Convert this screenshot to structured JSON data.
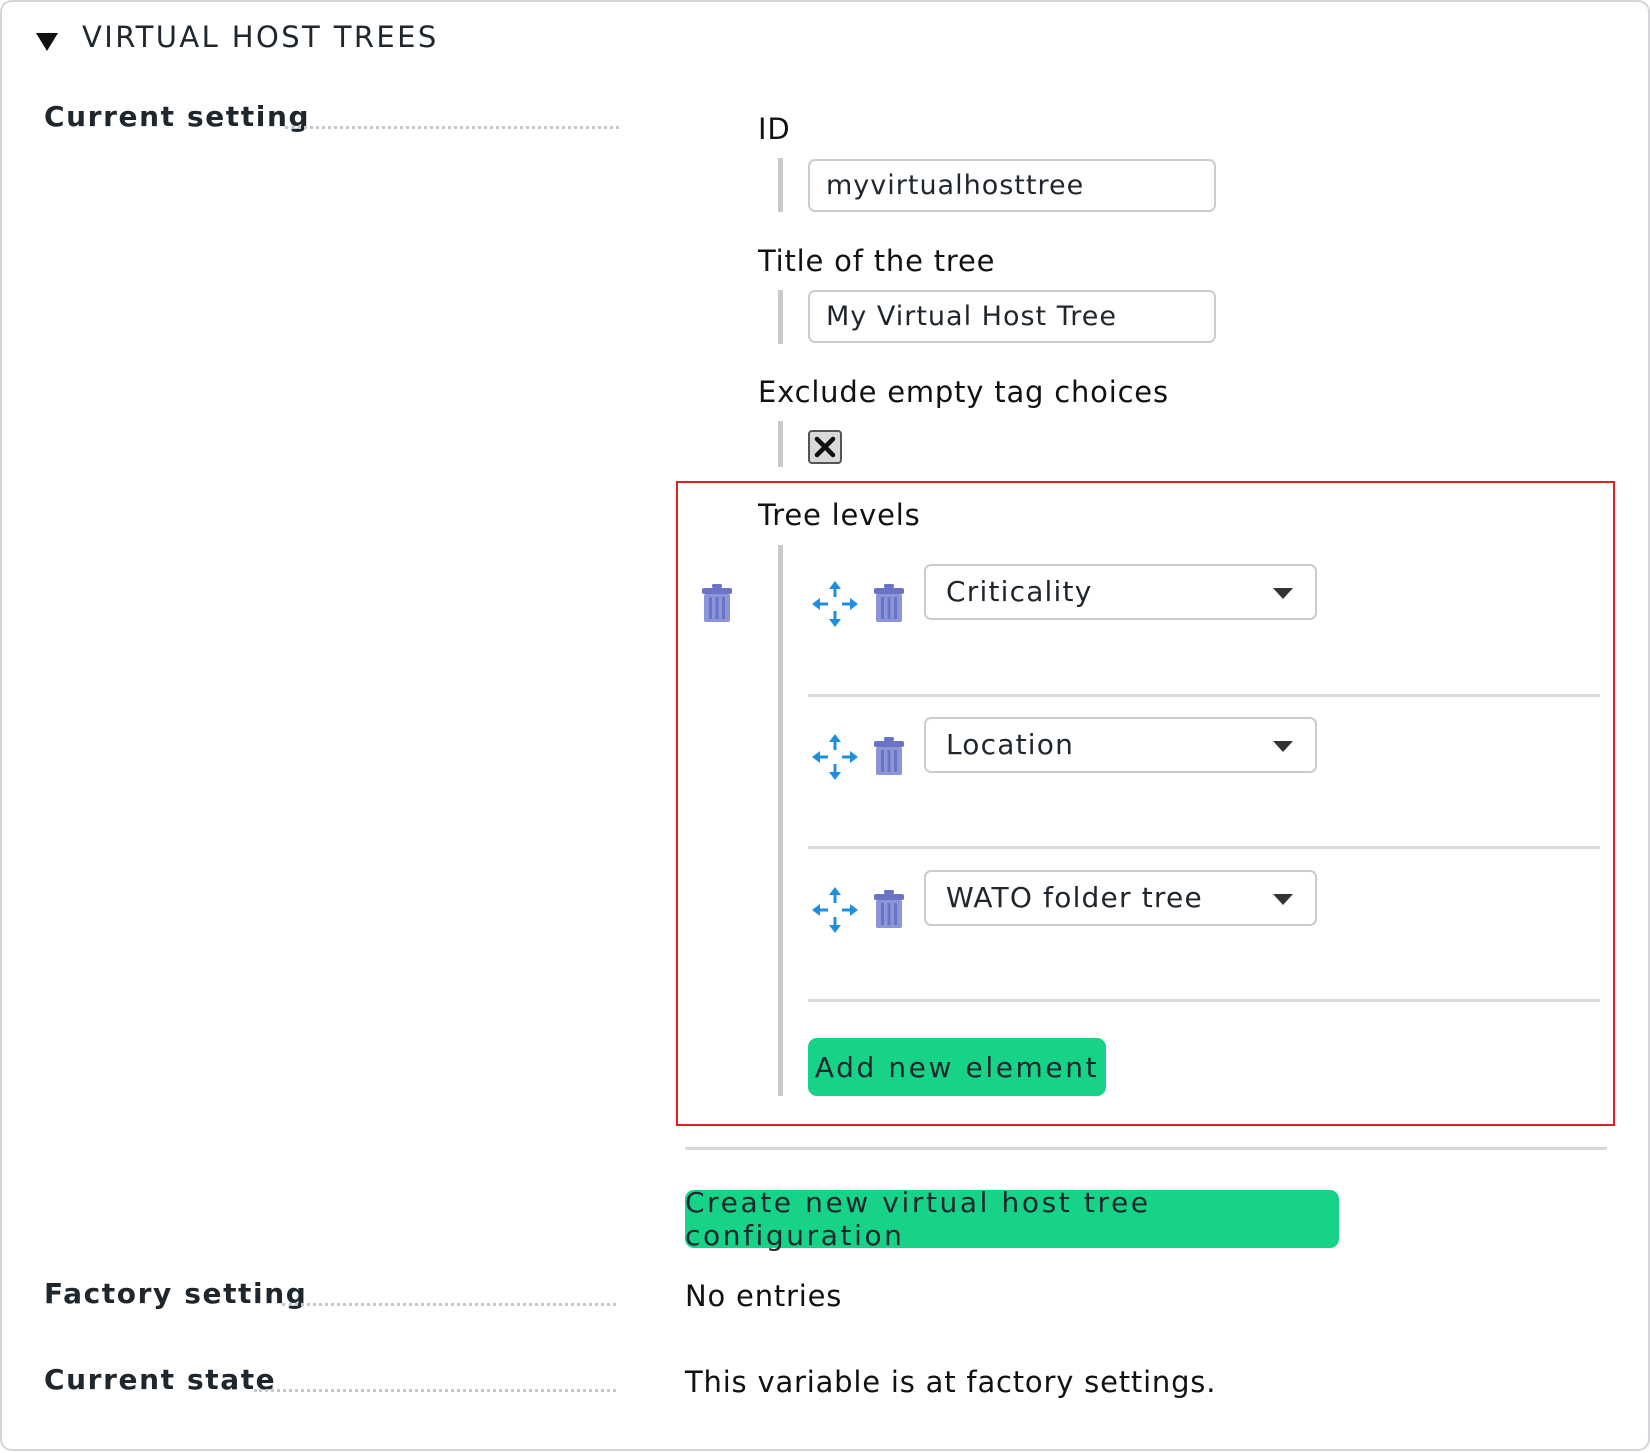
{
  "section": {
    "title": "VIRTUAL HOST TREES"
  },
  "current_setting": {
    "label": "Current setting",
    "id_label": "ID",
    "id_value": "myvirtualhosttree",
    "title_label": "Title of the tree",
    "title_value": "My Virtual Host Tree",
    "exclude_label": "Exclude empty tag choices",
    "exclude_checked": true,
    "tree_levels_label": "Tree levels",
    "levels": [
      {
        "value": "Criticality"
      },
      {
        "value": "Location"
      },
      {
        "value": "WATO folder tree"
      }
    ],
    "add_button_label": "Add new element",
    "create_button_label": "Create new virtual host tree configuration"
  },
  "factory_setting": {
    "label": "Factory setting",
    "value": "No entries"
  },
  "current_state": {
    "label": "Current state",
    "value": "This variable is at factory settings."
  },
  "colors": {
    "accent_green": "#16d388",
    "highlight_red": "#e31e24",
    "move_icon_blue": "#1e8fe0",
    "trash_icon_purple": "#6a74c4"
  },
  "icons": {
    "collapse": "triangle-down-icon",
    "move": "move-arrows-icon",
    "delete": "trash-icon",
    "checkbox": "x-checkmark-icon"
  }
}
